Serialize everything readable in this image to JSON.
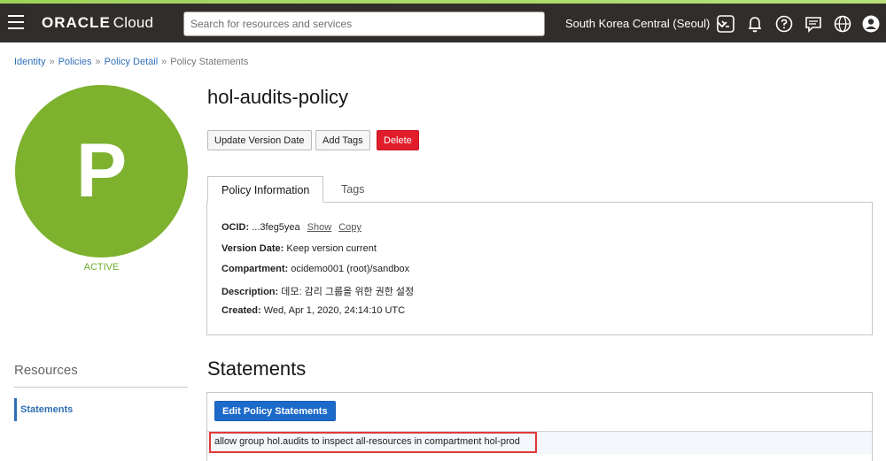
{
  "topbar": {
    "logo_brand": "ORACLE",
    "logo_product": "Cloud",
    "search_placeholder": "Search for resources and services",
    "region": "South Korea Central (Seoul)"
  },
  "breadcrumb": [
    "Identity",
    "Policies",
    "Policy Detail",
    "Policy Statements"
  ],
  "breadcrumb_sep": "»",
  "avatar_letter": "P",
  "status": "ACTIVE",
  "policy_name": "hol-audits-policy",
  "buttons": {
    "update_version": "Update Version Date",
    "add_tags": "Add Tags",
    "delete": "Delete"
  },
  "tabs": [
    "Policy Information",
    "Tags"
  ],
  "info": {
    "ocid_label": "OCID:",
    "ocid_value": "...3feg5yea",
    "show": "Show",
    "copy": "Copy",
    "version_label": "Version Date:",
    "version_value": "Keep version current",
    "compartment_label": "Compartment:",
    "compartment_value": "ocidemo001 (root)/sandbox",
    "description_label": "Description:",
    "description_value": "데모: 감리 그룹을 위한 권한 설정",
    "created_label": "Created:",
    "created_value": "Wed, Apr 1, 2020, 24:14:10 UTC"
  },
  "resources": {
    "title": "Resources",
    "item": "Statements"
  },
  "statements": {
    "title": "Statements",
    "edit_button": "Edit Policy Statements",
    "items": [
      "allow group hol.audits to inspect all-resources in compartment hol-prod"
    ]
  },
  "colors": {
    "topbar": "#312d2a",
    "avatar": "#7db12e",
    "link": "#2f6fb6",
    "danger": "#e11d2b",
    "primary": "#1c6ac9",
    "highlight": "#e03a3a"
  }
}
